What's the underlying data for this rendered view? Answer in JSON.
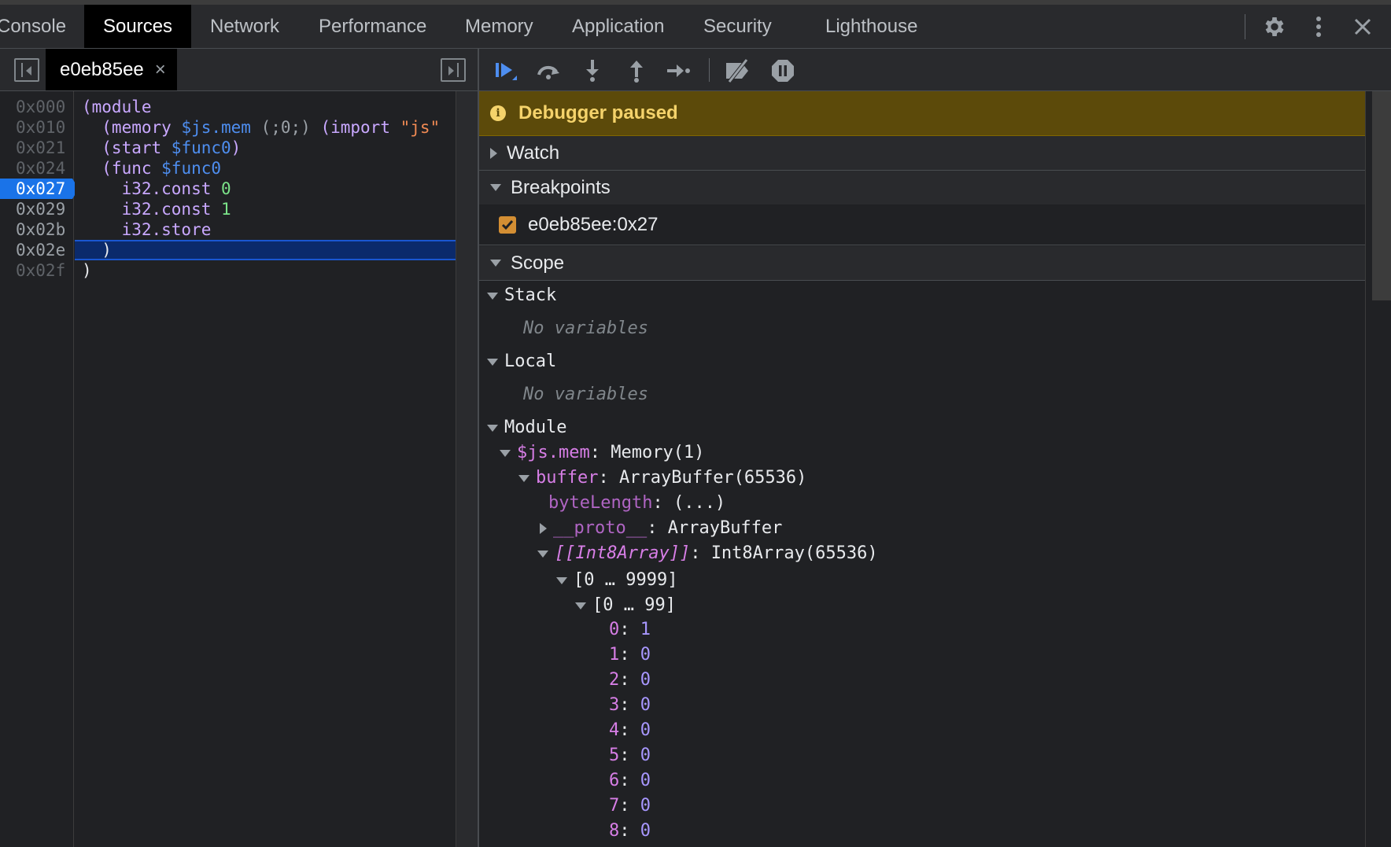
{
  "tabs": [
    "Console",
    "Sources",
    "Network",
    "Performance",
    "Memory",
    "Application",
    "Security",
    "Lighthouse"
  ],
  "active_tab": "Sources",
  "top_icons": [
    "gear-icon",
    "kebab-menu-icon",
    "close-icon"
  ],
  "file_tab": {
    "name": "e0eb85ee",
    "close": "×"
  },
  "editor": {
    "line_numbers": [
      "0x000",
      "0x010",
      "0x021",
      "0x024",
      "0x027",
      "0x029",
      "0x02b",
      "0x02e",
      "0x02f"
    ],
    "active_line": "0x027",
    "code": {
      "l0": "(module",
      "l1_open": "  (memory ",
      "l1_id": "$js.mem",
      "l1_cm": " (;0;)",
      "l1_imp": " (import ",
      "l1_str": "\"js\"",
      "l2_open": "  (start ",
      "l2_id": "$func0",
      "l2_close": ")",
      "l3_open": "  (func ",
      "l3_id": "$func0",
      "l4_kw": "    i32.const ",
      "l4_num": "0",
      "l5_kw": "    i32.const ",
      "l5_num": "1",
      "l6_kw": "    i32.store",
      "l7": "  )",
      "l8": ")"
    }
  },
  "debugger": {
    "toolbar_icons": [
      "resume-icon",
      "step-over-icon",
      "step-into-icon",
      "step-out-icon",
      "step-icon",
      "deactivate-breakpoints-icon",
      "pause-on-exceptions-icon"
    ],
    "paused_message": "Debugger paused",
    "sections": {
      "watch": "Watch",
      "breakpoints": "Breakpoints",
      "scope": "Scope"
    },
    "breakpoint": {
      "label": "e0eb85ee:0x27",
      "checked": true
    },
    "scope": {
      "stack": "Stack",
      "stack_empty": "No variables",
      "local": "Local",
      "local_empty": "No variables",
      "module": "Module",
      "mem_key": "$js.mem",
      "mem_val": "Memory(1)",
      "buffer_key": "buffer",
      "buffer_val": "ArrayBuffer(65536)",
      "bytelength_key": "byteLength",
      "bytelength_val": "(...)",
      "proto_key": "__proto__",
      "proto_val": "ArrayBuffer",
      "int8_key": "[[Int8Array]]",
      "int8_val": "Int8Array(65536)",
      "range1": "[0 … 9999]",
      "range2": "[0 … 99]",
      "entries": [
        {
          "k": "0",
          "v": "1"
        },
        {
          "k": "1",
          "v": "0"
        },
        {
          "k": "2",
          "v": "0"
        },
        {
          "k": "3",
          "v": "0"
        },
        {
          "k": "4",
          "v": "0"
        },
        {
          "k": "5",
          "v": "0"
        },
        {
          "k": "6",
          "v": "0"
        },
        {
          "k": "7",
          "v": "0"
        },
        {
          "k": "8",
          "v": "0"
        }
      ]
    }
  }
}
